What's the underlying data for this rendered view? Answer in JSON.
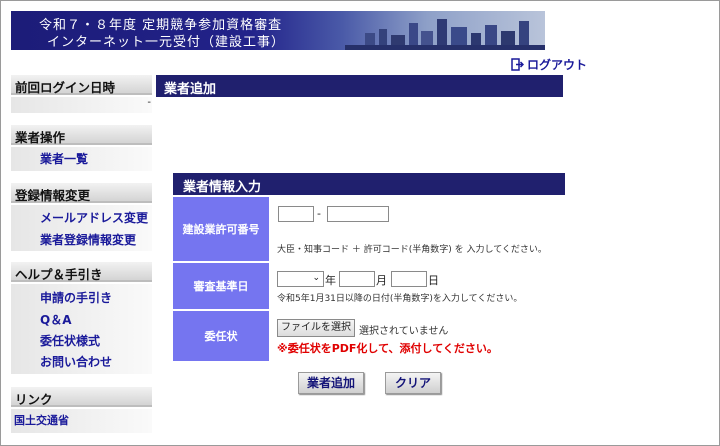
{
  "banner": {
    "line1": "令和７・８年度 定期競争参加資格審査",
    "line2": "インターネット一元受付（建設工事）"
  },
  "header": {
    "logout_label": "ログアウト"
  },
  "sidebar": {
    "last_login": {
      "heading": "前回ログイン日時",
      "value": "-"
    },
    "vendor_ops": {
      "heading": "業者操作",
      "items": [
        "業者一覧"
      ]
    },
    "registration": {
      "heading": "登録情報変更",
      "items": [
        "メールアドレス変更",
        "業者登録情報変更"
      ]
    },
    "help": {
      "heading": "ヘルプ＆手引き",
      "items": [
        "申請の手引き",
        "Q＆A",
        "委任状様式",
        "お問い合わせ"
      ]
    },
    "links": {
      "heading": "リンク",
      "items": [
        "国土交通省"
      ]
    }
  },
  "main": {
    "title": "業者追加"
  },
  "form": {
    "title": "業者情報入力",
    "license": {
      "label": "建設業許可番号",
      "separator": "-",
      "hint": "大臣・知事コード ＋ 許可コード(半角数字) を 入力してください。"
    },
    "base_date": {
      "label": "審査基準日",
      "year_unit": "年",
      "month_unit": "月",
      "day_unit": "日",
      "hint": "令和5年1月31日以降の日付(半角数字)を入力してください。"
    },
    "proxy": {
      "label": "委任状",
      "file_button": "ファイルを選択",
      "file_status": "選択されていません",
      "warning": "※委任状をPDF化して、添付してください。"
    }
  },
  "buttons": {
    "add": "業者追加",
    "clear": "クリア"
  },
  "colors": {
    "navy": "#20206e",
    "label_bg": "#7575f0",
    "link": "#1a1a9a",
    "warning": "#e00000"
  }
}
